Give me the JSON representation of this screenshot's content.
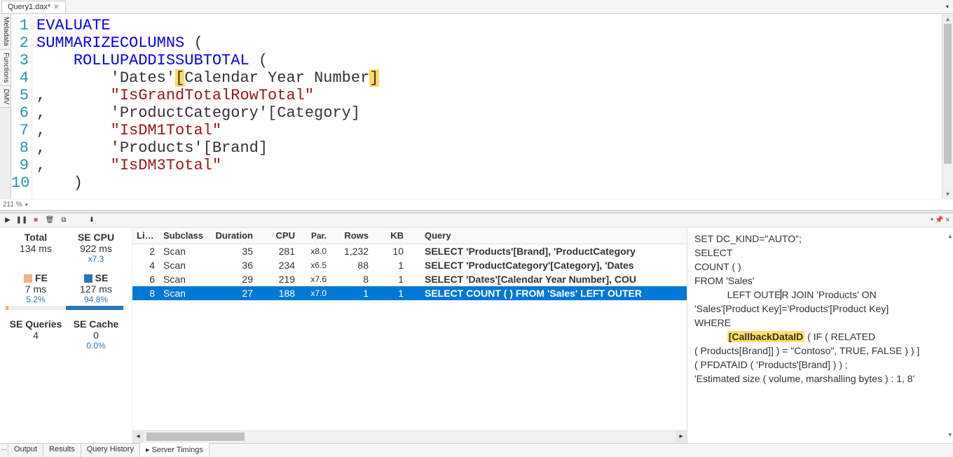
{
  "tab": {
    "title": "Query1.dax*"
  },
  "side_tabs": [
    "Metadata",
    "Functions",
    "DMV"
  ],
  "editor": {
    "zoom": "211 %",
    "lines": [
      [
        {
          "t": "EVALUATE",
          "c": "kw"
        }
      ],
      [
        {
          "t": "SUMMARIZECOLUMNS ",
          "c": "kw"
        },
        {
          "t": "(",
          "c": "ident"
        }
      ],
      [
        {
          "t": "    ",
          "c": "ident"
        },
        {
          "t": "ROLLUPADDISSUBTOTAL ",
          "c": "kw"
        },
        {
          "t": "(",
          "c": "ident"
        }
      ],
      [
        {
          "t": "        'Dates'",
          "c": "ident"
        },
        {
          "t": "[",
          "c": "hl-br"
        },
        {
          "t": "Calendar Year Number",
          "c": "ident"
        },
        {
          "t": "]",
          "c": "hl-br"
        }
      ],
      [
        {
          "t": ",       ",
          "c": "ident"
        },
        {
          "t": "\"IsGrandTotalRowTotal\"",
          "c": "str"
        }
      ],
      [
        {
          "t": ",       'ProductCategory'[Category]",
          "c": "ident"
        }
      ],
      [
        {
          "t": ",       ",
          "c": "ident"
        },
        {
          "t": "\"IsDM1Total\"",
          "c": "str"
        }
      ],
      [
        {
          "t": ",       'Products'[Brand]",
          "c": "ident"
        }
      ],
      [
        {
          "t": ",       ",
          "c": "ident"
        },
        {
          "t": "\"IsDM3Total\"",
          "c": "str"
        }
      ],
      [
        {
          "t": "    )",
          "c": "ident"
        }
      ]
    ]
  },
  "stats": {
    "total_label": "Total",
    "total_val": "134 ms",
    "secpu_label": "SE CPU",
    "secpu_val": "922 ms",
    "secpu_sub": "x7.3",
    "fe_label": "FE",
    "fe_val": "7 ms",
    "fe_pct": "5.2%",
    "fe_bar": 5.2,
    "se_label": "SE",
    "se_val": "127 ms",
    "se_pct": "94.8%",
    "se_bar": 94.8,
    "seq_label": "SE Queries",
    "seq_val": "4",
    "secache_label": "SE Cache",
    "secache_val": "0",
    "secache_pct": "0.0%"
  },
  "grid": {
    "headers": [
      "Line",
      "Subclass",
      "Duration",
      "CPU",
      "Par.",
      "Rows",
      "KB",
      "",
      "Query"
    ],
    "rows": [
      {
        "line": "2",
        "sub": "Scan",
        "dur": "35",
        "cpu": "281",
        "par": "x8.0",
        "rows": "1,232",
        "kb": "10",
        "q": "SELECT 'Products'[Brand], 'ProductCategory",
        "sel": false
      },
      {
        "line": "4",
        "sub": "Scan",
        "dur": "36",
        "cpu": "234",
        "par": "x6.5",
        "rows": "88",
        "kb": "1",
        "q": "SELECT 'ProductCategory'[Category], 'Dates",
        "sel": false
      },
      {
        "line": "6",
        "sub": "Scan",
        "dur": "29",
        "cpu": "219",
        "par": "x7.6",
        "rows": "8",
        "kb": "1",
        "q": "SELECT 'Dates'[Calendar Year Number], COU",
        "sel": false
      },
      {
        "line": "8",
        "sub": "Scan",
        "dur": "27",
        "cpu": "188",
        "par": "x7.0",
        "rows": "1",
        "kb": "1",
        "q": "SELECT COUNT (  )  FROM 'Sales'  LEFT OUTER",
        "sel": true
      }
    ]
  },
  "detail": {
    "l1": "SET DC_KIND=\"AUTO\";",
    "l2": "SELECT",
    "l3": "COUNT (  )",
    "l4": "FROM 'Sales'",
    "l5a": "            LEFT OUTE",
    "l5b": "R JOIN 'Products' ON",
    "l6": "'Sales'[Product Key]='Products'[Product Key]",
    "l7": "WHERE",
    "l8pre": "            ",
    "l8hl": "[CallbackDataID",
    "l8post": " ( IF ( RELATED",
    "l9": "( Products[Brand]] ) = \"Contoso\", TRUE, FALSE )  ) ]",
    "l10": "( PFDATAID ( 'Products'[Brand] )  ) ;",
    "l11": "",
    "l12": "",
    "l13": "'Estimated size ( volume, marshalling bytes ) : 1, 8'"
  },
  "bottom_tabs": [
    "Output",
    "Results",
    "Query History",
    "Server Timings"
  ],
  "bottom_active": 3
}
